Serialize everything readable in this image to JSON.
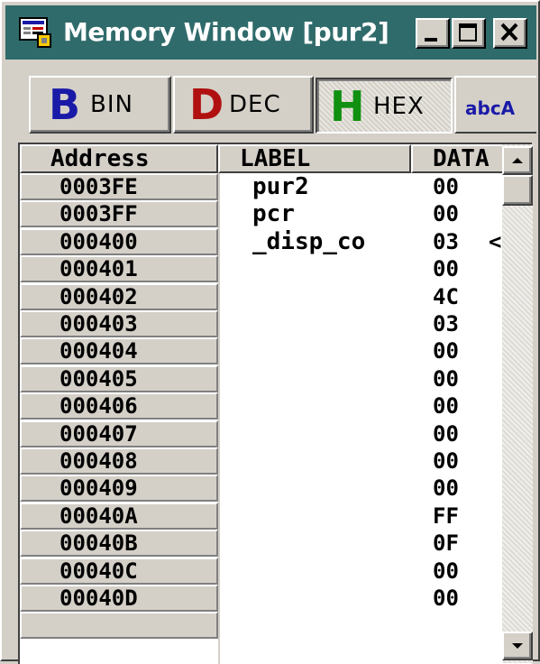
{
  "window": {
    "title": "Memory Window [pur2]",
    "title_bar_color": "#306b6b",
    "buttons": [
      "minimize-icon",
      "maximize-icon",
      "close-icon"
    ]
  },
  "tabs": [
    {
      "glyph": "B",
      "glyph_color": "#1a1aa8",
      "label": "BIN",
      "active": false
    },
    {
      "glyph": "D",
      "glyph_color": "#b01010",
      "label": "DEC",
      "active": false
    },
    {
      "glyph": "H",
      "glyph_color": "#109010",
      "label": "HEX",
      "active": true
    },
    {
      "glyph": "abcA",
      "glyph_color": "#1a1aa8",
      "label": "",
      "active": false
    }
  ],
  "columns": {
    "address": "Address",
    "label": "LABEL",
    "data": "DATA"
  },
  "rows": [
    {
      "address": "0003FE",
      "label": "pur2",
      "data": "00",
      "marker": ""
    },
    {
      "address": "0003FF",
      "label": "pcr",
      "data": "00",
      "marker": ""
    },
    {
      "address": "000400",
      "label": "_disp_co",
      "data": "03",
      "marker": "<"
    },
    {
      "address": "000401",
      "label": "",
      "data": "00",
      "marker": ""
    },
    {
      "address": "000402",
      "label": "",
      "data": "4C",
      "marker": ""
    },
    {
      "address": "000403",
      "label": "",
      "data": "03",
      "marker": ""
    },
    {
      "address": "000404",
      "label": "",
      "data": "00",
      "marker": ""
    },
    {
      "address": "000405",
      "label": "",
      "data": "00",
      "marker": ""
    },
    {
      "address": "000406",
      "label": "",
      "data": "00",
      "marker": ""
    },
    {
      "address": "000407",
      "label": "",
      "data": "00",
      "marker": ""
    },
    {
      "address": "000408",
      "label": "",
      "data": "00",
      "marker": ""
    },
    {
      "address": "000409",
      "label": "",
      "data": "00",
      "marker": ""
    },
    {
      "address": "00040A",
      "label": "",
      "data": "FF",
      "marker": ""
    },
    {
      "address": "00040B",
      "label": "",
      "data": "0F",
      "marker": ""
    },
    {
      "address": "00040C",
      "label": "",
      "data": "00",
      "marker": ""
    },
    {
      "address": "00040D",
      "label": "",
      "data": "00",
      "marker": ""
    }
  ]
}
